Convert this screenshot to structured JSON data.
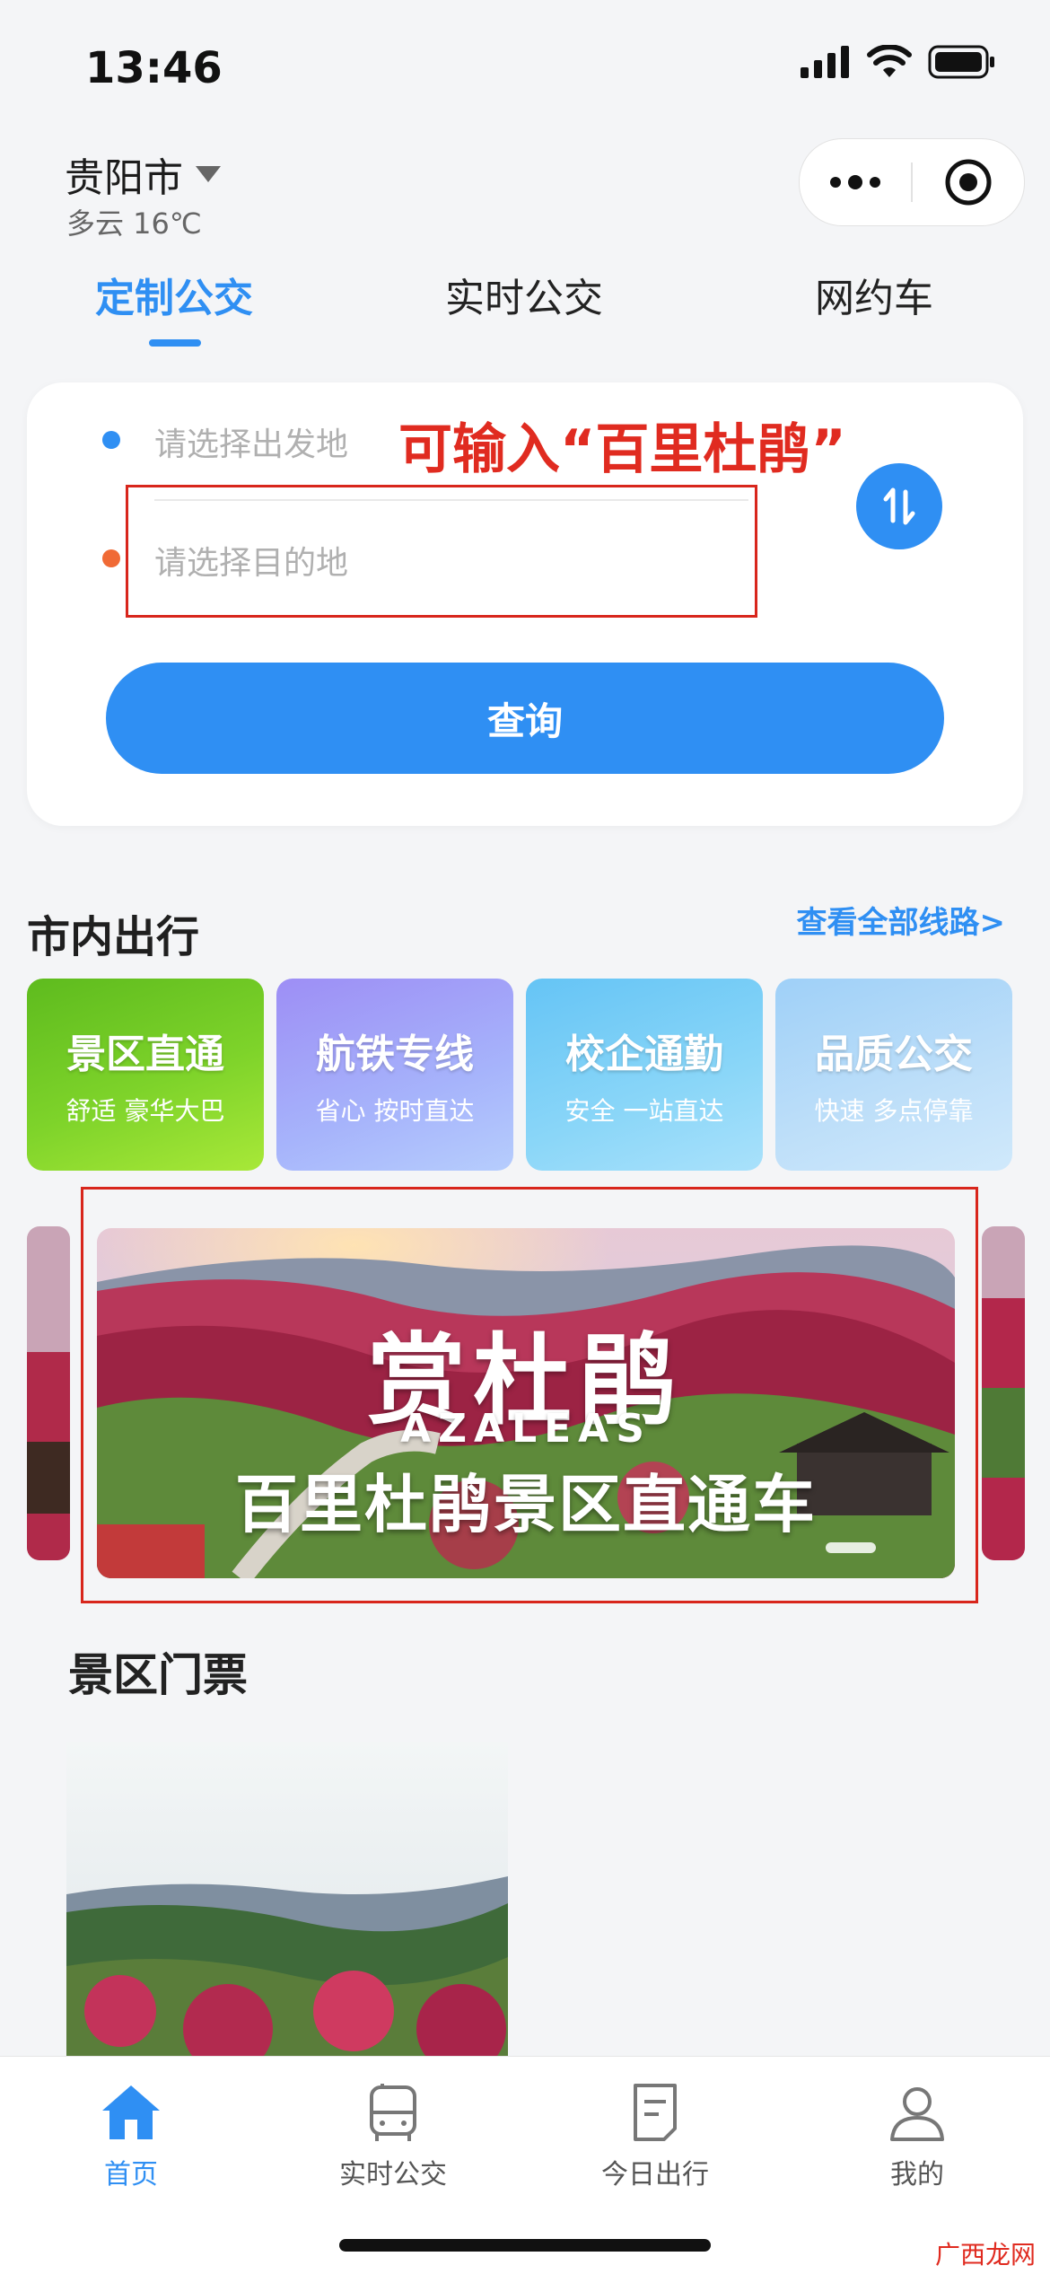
{
  "status_bar": {
    "time": "13:46"
  },
  "header": {
    "city": "贵阳市",
    "weather": "多云 16℃"
  },
  "capsule": {
    "more_icon": "more-dots-icon",
    "close_icon": "target-circle-icon"
  },
  "tabs": [
    {
      "label": "定制公交",
      "active": true
    },
    {
      "label": "实时公交",
      "active": false
    },
    {
      "label": "网约车",
      "active": false
    }
  ],
  "search": {
    "origin_placeholder": "请选择出发地",
    "destination_placeholder": "请选择目的地",
    "swap_icon": "swap-icon",
    "query_label": "查询",
    "annotation": "可输入“百里杜鹃”"
  },
  "city_travel": {
    "title": "市内出行",
    "view_all": "查看全部线路>",
    "categories": [
      {
        "title": "景区直通",
        "subtitle": "舒适  豪华大巴"
      },
      {
        "title": "航铁专线",
        "subtitle": "省心  按时直达"
      },
      {
        "title": "校企通勤",
        "subtitle": "安全  一站直达"
      },
      {
        "title": "品质公交",
        "subtitle": "快速  多点停靠"
      }
    ]
  },
  "banner": {
    "line1": "赏杜鹃",
    "line2": "AZALEAS",
    "line3": "百里杜鹃景区直通车"
  },
  "tickets": {
    "title": "景区门票"
  },
  "tabbar": [
    {
      "label": "首页",
      "icon": "home-icon",
      "active": true
    },
    {
      "label": "实时公交",
      "icon": "bus-icon",
      "active": false
    },
    {
      "label": "今日出行",
      "icon": "document-icon",
      "active": false
    },
    {
      "label": "我的",
      "icon": "user-icon",
      "active": false
    }
  ],
  "watermark": "广西龙网",
  "colors": {
    "accent": "#2f8ff3",
    "annotation_red": "#e02b20",
    "origin_dot": "#2f8ff3",
    "destination_dot": "#f06a35"
  }
}
